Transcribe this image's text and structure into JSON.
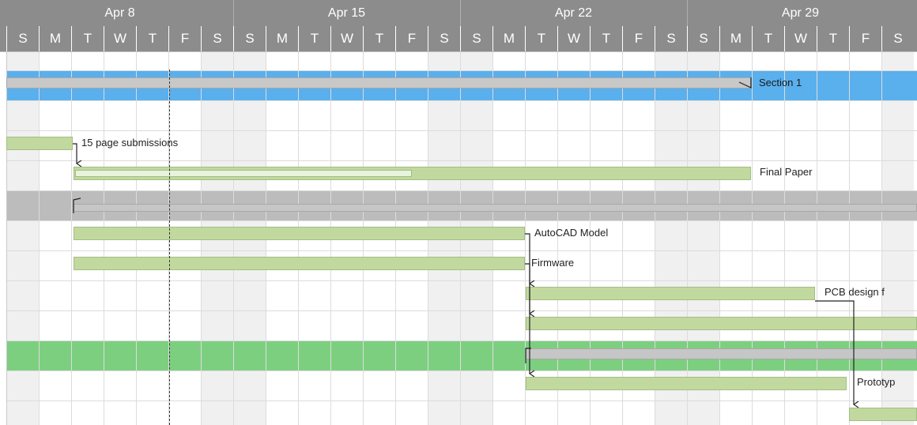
{
  "timeline": {
    "weeks": [
      "Apr 8",
      "Apr 15",
      "Apr 22",
      "Apr 29"
    ],
    "day_letters": [
      "S",
      "M",
      "T",
      "W",
      "T",
      "F",
      "S",
      "S",
      "M",
      "T",
      "W",
      "T",
      "F",
      "S",
      "S",
      "M",
      "T",
      "W",
      "T",
      "F",
      "S",
      "S",
      "M",
      "T",
      "W",
      "T",
      "F",
      "S"
    ]
  },
  "rows": {
    "section": "Section 1",
    "tasks": {
      "page_submissions": "15 page submissions",
      "final_paper": "Final Paper",
      "autocad_model": "AutoCAD Model",
      "firmware": "Firmware",
      "pcb_design": "PCB design f",
      "prototype": "Prototyp"
    }
  },
  "colors": {
    "header": "#8c8c8c",
    "section_row": "#5aafed",
    "group_row": "#bcbcbc",
    "highlight_row": "#7dcf80",
    "task_bar": "#c1d99e",
    "summary_bar": "#c6c6c6"
  }
}
